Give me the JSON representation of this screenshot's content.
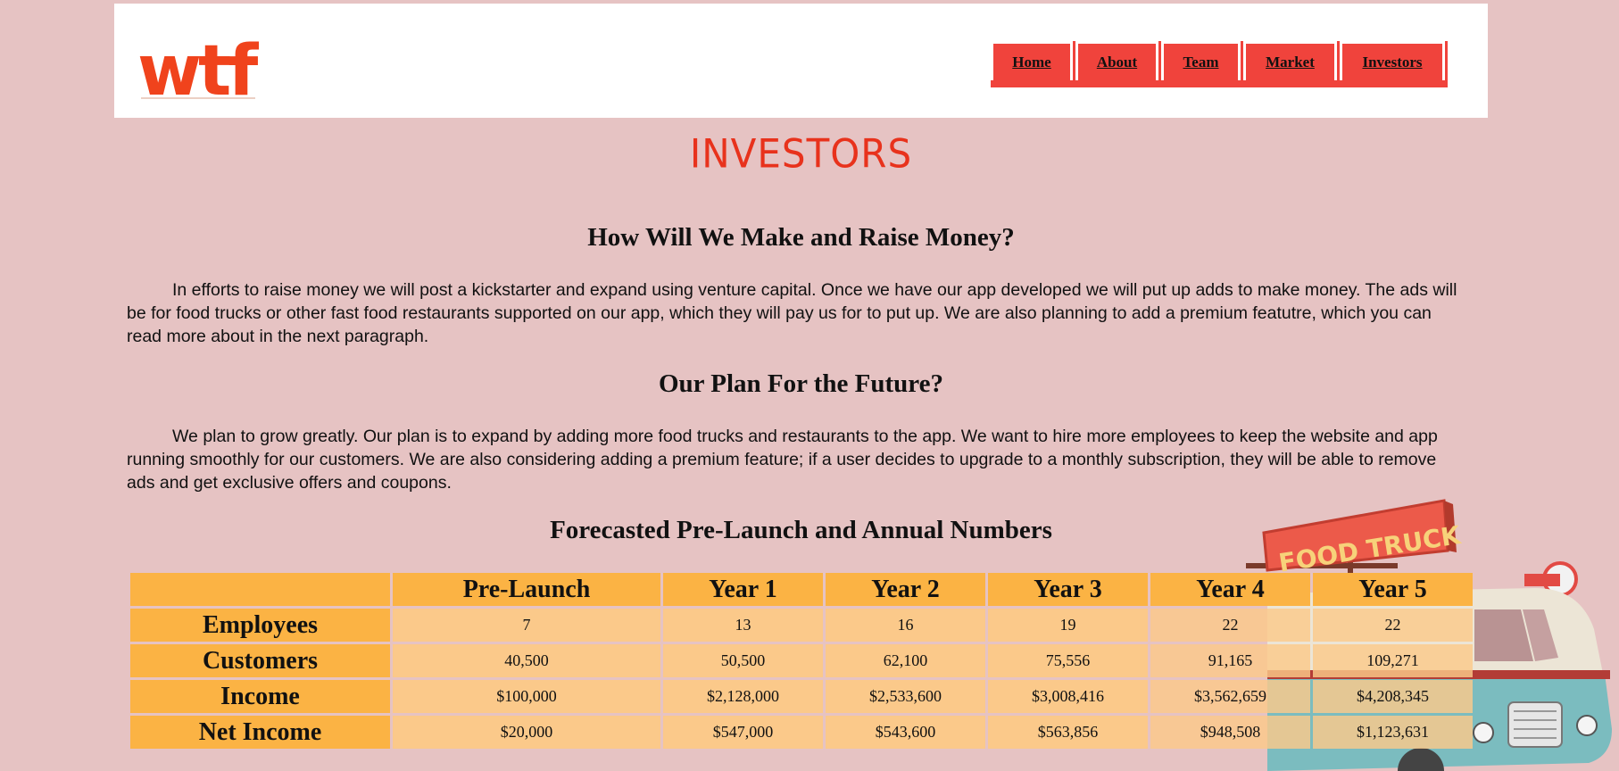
{
  "header": {
    "logo_text": "wtf",
    "nav": [
      {
        "label": "Home"
      },
      {
        "label": "About"
      },
      {
        "label": "Team"
      },
      {
        "label": "Market"
      },
      {
        "label": "Investors"
      }
    ]
  },
  "page": {
    "title": "INVESTORS"
  },
  "sections": [
    {
      "heading": "How Will We Make and Raise Money?",
      "body": "In efforts to raise money we will post a kickstarter and expand using venture capital. Once we have our app developed we will put up adds to make money. The ads will be for food trucks or other fast food restaurants supported on our app, which they will pay us for to put up. We are also planning to add a premium featutre, which you can read more about in the next paragraph."
    },
    {
      "heading": "Our Plan For the Future?",
      "body": "We plan to grow greatly. Our plan is to expand by adding more food trucks and restaurants to the app. We want to hire more employees to keep the website and app running smoothly for our customers. We are also considering adding a premium feature; if a user decides to upgrade to a monthly subscription, they will be able to remove ads and get exclusive offers and coupons."
    },
    {
      "heading": "Forecasted Pre-Launch and Annual Numbers"
    }
  ],
  "table": {
    "columns": [
      "",
      "Pre-Launch",
      "Year 1",
      "Year 2",
      "Year 3",
      "Year 4",
      "Year 5"
    ],
    "rows": [
      {
        "label": "Employees",
        "values": [
          "7",
          "13",
          "16",
          "19",
          "22",
          "22"
        ]
      },
      {
        "label": "Customers",
        "values": [
          "40,500",
          "50,500",
          "62,100",
          "75,556",
          "91,165",
          "109,271"
        ]
      },
      {
        "label": "Income",
        "values": [
          "$100,000",
          "$2,128,000",
          "$2,533,600",
          "$3,008,416",
          "$3,562,659",
          "$4,208,345"
        ]
      },
      {
        "label": "Net Income",
        "values": [
          "$20,000",
          "$547,000",
          "$543,600",
          "$563,856",
          "$948,508",
          "$1,123,631"
        ]
      }
    ]
  },
  "truck_sign": "FOOD TRUCK",
  "colors": {
    "background": "#e6c3c3",
    "nav_red": "#f0433c",
    "title_red": "#e8321c",
    "table_header": "#fbb344",
    "table_cell": "#fbc98a"
  }
}
